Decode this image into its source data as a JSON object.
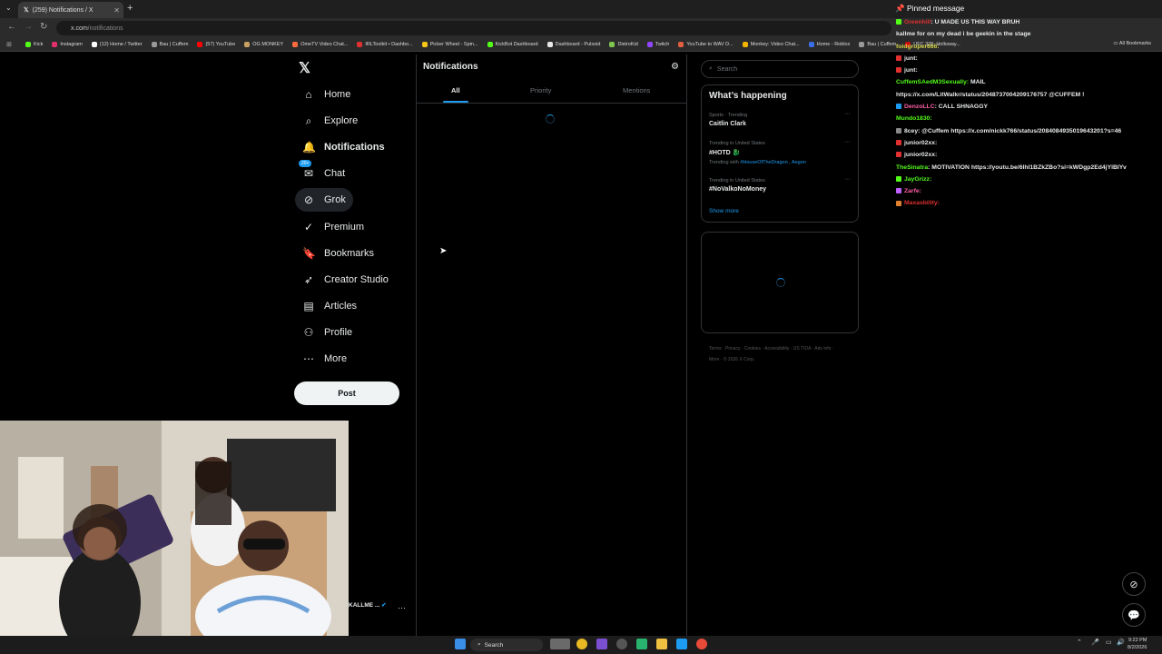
{
  "browser": {
    "tab_title": "(259) Notifications / X",
    "url_host": "x.com",
    "url_path": "/notifications",
    "bookmarks": [
      {
        "label": "Kick",
        "color": "#53fc18"
      },
      {
        "label": "Instagram",
        "color": "#e1306c"
      },
      {
        "label": "(12) Home / Twitter",
        "color": "#ffffff"
      },
      {
        "label": "Bau | Cuffem",
        "color": "#999999"
      },
      {
        "label": "(57) YouTube",
        "color": "#ff0000"
      },
      {
        "label": "OG MONKEY",
        "color": "#c8a060"
      },
      {
        "label": "OmeTV Video Chat...",
        "color": "#ff6a3d"
      },
      {
        "label": "IRLToolkit • Dashbo...",
        "color": "#e03030"
      },
      {
        "label": "Picker Wheel - Spin...",
        "color": "#f5c518"
      },
      {
        "label": "KickBot Dashboard",
        "color": "#53fc18"
      },
      {
        "label": "Dashboard - Pulsoid",
        "color": "#e8e8e8"
      },
      {
        "label": "DistroKid",
        "color": "#7ec850"
      },
      {
        "label": "Twitch",
        "color": "#9146ff"
      },
      {
        "label": "YouTube to WAV D...",
        "color": "#e06040"
      },
      {
        "label": "Monkey: Video Chat...",
        "color": "#f4b400"
      },
      {
        "label": "Home - Roblox",
        "color": "#3a6fe8"
      },
      {
        "label": "Bau | Cuffem",
        "color": "#999999"
      },
      {
        "label": "UFC 326: Holloway...",
        "color": "#d20a0a"
      }
    ],
    "all_bookmarks": "All Bookmarks"
  },
  "sidebar": {
    "items": [
      {
        "label": "Home",
        "icon": "home-icon",
        "glyph": "⌂"
      },
      {
        "label": "Explore",
        "icon": "search-icon",
        "glyph": "⌕"
      },
      {
        "label": "Notifications",
        "icon": "bell-icon",
        "glyph": "🔔"
      },
      {
        "label": "Chat",
        "icon": "chat-icon",
        "glyph": "✉"
      },
      {
        "label": "Grok",
        "icon": "grok-icon",
        "glyph": "⊘"
      },
      {
        "label": "Premium",
        "icon": "premium-icon",
        "glyph": "✓"
      },
      {
        "label": "Bookmarks",
        "icon": "bookmark-icon",
        "glyph": "🔖"
      },
      {
        "label": "Creator Studio",
        "icon": "rocket-icon",
        "glyph": "➶"
      },
      {
        "label": "Articles",
        "icon": "article-icon",
        "glyph": "▤"
      },
      {
        "label": "Profile",
        "icon": "person-icon",
        "glyph": "⚇"
      },
      {
        "label": "More",
        "icon": "more-icon",
        "glyph": "⋯"
      }
    ],
    "chat_badge": "20+",
    "post_label": "Post",
    "account_name": "KALLME ..."
  },
  "feed": {
    "title": "Notifications",
    "tabs": [
      "All",
      "Priority",
      "Mentions"
    ]
  },
  "right": {
    "search_placeholder": "Search",
    "happening_title": "What’s happening",
    "trends": [
      {
        "meta": "Sports · Trending",
        "name": "Caitlin Clark",
        "with": ""
      },
      {
        "meta": "Trending in United States",
        "name": "#HOTD",
        "with_prefix": "Trending with",
        "with_tags": "#HouseOfTheDragon , Aegon"
      },
      {
        "meta": "Trending in United States",
        "name": "#NoValkoNoMoney",
        "with": ""
      }
    ],
    "show_more": "Show more",
    "footer": "Terms · Privacy · Cookies · Accessibility · US TIDA · Ads info · More · © 2026 X Corp."
  },
  "chat": {
    "pinned": "Pinned message",
    "messages": [
      {
        "user": "Greenhill",
        "color": "#e03030",
        "text": ": U MADE US THIS WAY BRUH",
        "badge": "#53fc18"
      },
      {
        "user": "",
        "color": "#ffffff",
        "text": "kallme for on my dead i be geekin in the stage",
        "badge": ""
      },
      {
        "user": "foidgroper666:",
        "color": "#d4d44a",
        "text": "",
        "badge": ""
      },
      {
        "user": "junt:",
        "color": "#e7e9ea",
        "text": "",
        "badge": "#e03030"
      },
      {
        "user": "junt:",
        "color": "#e7e9ea",
        "text": "",
        "badge": "#e03030"
      },
      {
        "user": "CuffemSAedM3Sexually:",
        "color": "#53fc18",
        "text": " MAIL",
        "badge": ""
      },
      {
        "user": "",
        "color": "#e7e9ea",
        "text": "https://x.com/LitWalkr/status/2048737004209176757 @CUFFEM !",
        "badge": ""
      },
      {
        "user": "DenzoLLC",
        "color": "#ff5fa8",
        "text": ": CALL SHNAGGY",
        "badge": "#1d9bf0"
      },
      {
        "user": "Mundo1830:",
        "color": "#53fc18",
        "text": "",
        "badge": ""
      },
      {
        "user": "8cey:",
        "color": "#e7e9ea",
        "text": " @Cuffem https://x.com/nickk766/status/2084084935019643201?s=46",
        "badge": "#888888"
      },
      {
        "user": "junior02xx:",
        "color": "#e7e9ea",
        "text": "",
        "badge": "#e03030"
      },
      {
        "user": "junior02xx:",
        "color": "#e7e9ea",
        "text": "",
        "badge": "#e03030"
      },
      {
        "user": "TheSinatra",
        "color": "#53fc18",
        "text": ": MOTIVATION https://youtu.be/6lhl1BZkZBo?si=kWDgp2Ed4jYlBIYv",
        "badge": ""
      },
      {
        "user": "JayGrizz:",
        "color": "#53fc18",
        "text": "",
        "badge": "#53fc18"
      },
      {
        "user": "Zarfe:",
        "color": "#ff5fa8",
        "text": "",
        "badge": "#c060ff"
      },
      {
        "user": "Maxasbility:",
        "color": "#e03030",
        "text": "",
        "badge": "#e08030"
      }
    ]
  },
  "taskbar": {
    "search_label": "Search",
    "time": "9:22 PM",
    "date": "8/2/2026"
  }
}
